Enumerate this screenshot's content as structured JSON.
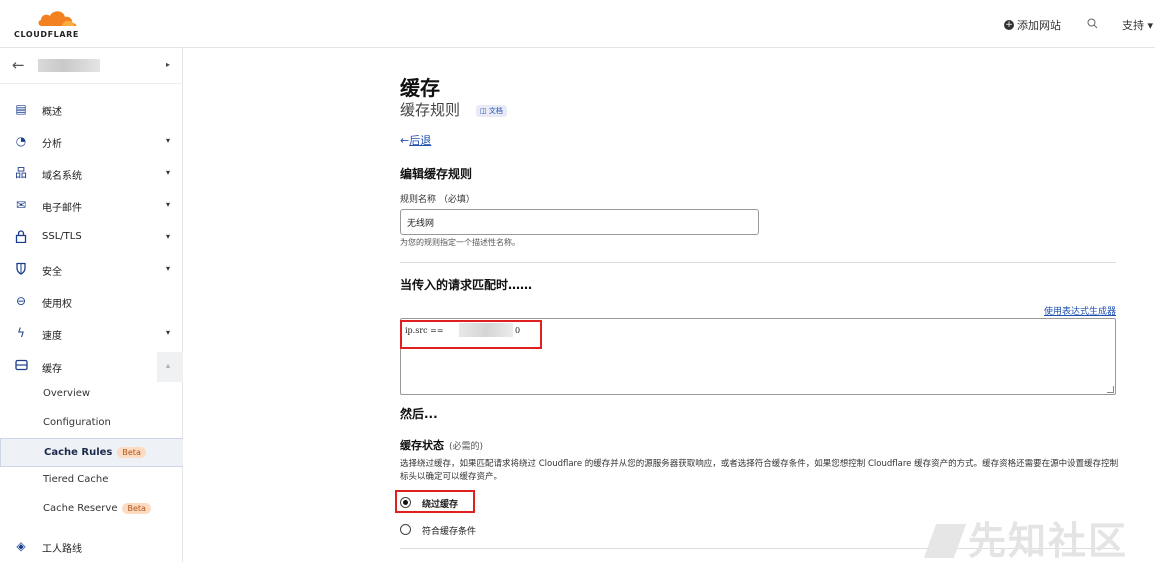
{
  "header": {
    "brand": "CLOUDFLARE",
    "add_site": "添加网站",
    "support": "支持 ▾"
  },
  "sidebar": {
    "items": [
      {
        "label": "概述",
        "icon": "document-icon",
        "glyph": "▤"
      },
      {
        "label": "分析",
        "icon": "clock-icon",
        "glyph": "◔"
      },
      {
        "label": "域名系统",
        "icon": "network-icon",
        "glyph": "品"
      },
      {
        "label": "电子邮件",
        "icon": "email-icon",
        "glyph": "✉"
      },
      {
        "label": "SSL/TLS",
        "icon": "lock-icon",
        "glyph": "🔒"
      },
      {
        "label": "安全",
        "icon": "shield-icon",
        "glyph": "◡"
      },
      {
        "label": "使用权",
        "icon": "access-icon",
        "glyph": "⊖"
      },
      {
        "label": "速度",
        "icon": "lightning-icon",
        "glyph": "ϟ"
      },
      {
        "label": "缓存",
        "icon": "cache-icon",
        "glyph": "▭"
      }
    ],
    "sub_items": [
      {
        "label": "Overview"
      },
      {
        "label": "Configuration"
      },
      {
        "label": "Cache Rules",
        "badge": "Beta"
      },
      {
        "label": "Tiered Cache"
      },
      {
        "label": "Cache Reserve",
        "badge": "Beta"
      }
    ],
    "last_item": {
      "label": "工人路线",
      "icon": "workers-icon",
      "glyph": "◈"
    }
  },
  "page": {
    "title": "缓存",
    "subtitle": "缓存规则",
    "docs_label": "◫ 文档",
    "back_label": "后退",
    "edit_title": "编辑缓存规则",
    "rule_name_label": "规则名称 （必填）",
    "rule_name_value": "无线网",
    "rule_name_help": "为您的规则指定一个描述性名称。",
    "match_title": "当传入的请求匹配时……",
    "expression_builder_link": "使用表达式生成器",
    "expression_prefix": "ip.src == ",
    "expression_suffix": "0",
    "then_title": "然后...",
    "cache_status_label": "缓存状态",
    "cache_status_required": "(必需的)",
    "cache_status_desc": "选择绕过缓存，如果匹配请求将绕过 Cloudflare 的缓存并从您的源服务器获取响应，或者选择符合缓存条件，如果您想控制 Cloudflare 缓存资产的方式。缓存资格还需要在源中设置缓存控制标头以确定可以缓存资产。",
    "options": [
      {
        "label": "绕过缓存",
        "selected": true
      },
      {
        "label": "符合缓存条件",
        "selected": false
      }
    ],
    "watermark": "先知社区"
  }
}
